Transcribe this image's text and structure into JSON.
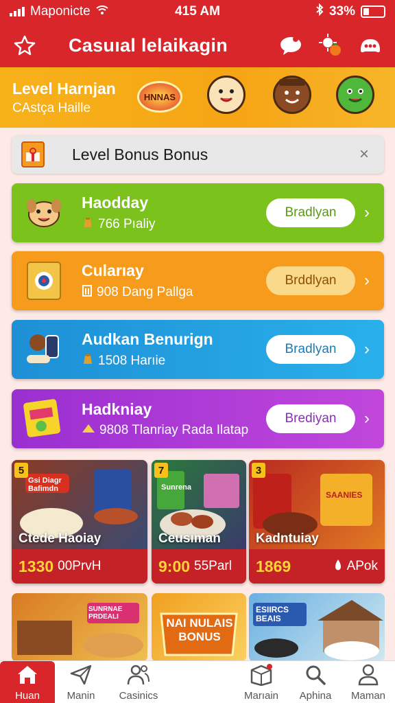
{
  "status_bar": {
    "carrier": "Maponicte",
    "time": "415 AM",
    "battery": "33%"
  },
  "app_bar": {
    "title": "Casuıal lelaikagin"
  },
  "banner": {
    "title": "Level Harnjan",
    "subtitle": "CAstça Haille",
    "badge_text": "HNNAS"
  },
  "notice": {
    "text": "Level Bonus Bonus",
    "close_label": "×"
  },
  "cards": [
    {
      "title": "Haodday",
      "subtitle": "766 Pıaliy",
      "button": "Bradlyan",
      "color": "#7bc21c",
      "button_text_color": "#5a9a12"
    },
    {
      "title": "Cularıay",
      "subtitle": "908 Dang Pallga",
      "button": "Brddlyan",
      "color": "#f79b1c",
      "button_text_color": "#8a5200"
    },
    {
      "title": "Audkan Benurign",
      "subtitle": "1508 Harıie",
      "button": "Bradlyan",
      "color": "#1f9edc",
      "button_text_color": "#1c7bb5"
    },
    {
      "title": "Hadkniay",
      "subtitle": "9808 Tlanriay  Rada Ilatap",
      "button": "Brediyan",
      "color": "#a437d4",
      "button_text_color": "#8a2fb8"
    }
  ],
  "tiles": [
    {
      "num": "5",
      "label_top": "Gsi Diagr Bafimdn",
      "name": "Ctede Haoiay",
      "price": "1330",
      "sub": "00PrvH"
    },
    {
      "num": "7",
      "label_top": "Sunrena",
      "name": "Ceusıman",
      "price": "9:00",
      "sub": "55Parl"
    },
    {
      "num": "3",
      "label_top": "SAANIES",
      "name": "Kadntuiay",
      "price": "1869",
      "sub": "APok"
    }
  ],
  "bottom_tiles": [
    {
      "label": "SUNRNAE PRDEALI"
    },
    {
      "label": "NAI NULAIS BONUS"
    },
    {
      "label": "ESIIRCS BEAIS"
    }
  ],
  "nav": [
    {
      "label": "Huan",
      "icon": "home-icon",
      "active": true
    },
    {
      "label": "Manin",
      "icon": "send-icon",
      "active": false
    },
    {
      "label": "Casinics",
      "icon": "people-icon",
      "active": false
    },
    {
      "label": "Marıain",
      "icon": "box-icon",
      "active": false
    },
    {
      "label": "Aphina",
      "icon": "search-icon",
      "active": false
    },
    {
      "label": "Maman",
      "icon": "profile-icon",
      "active": false
    }
  ],
  "colors": {
    "primary_red": "#d8262b",
    "banner_orange": "#f7b21a",
    "price_yellow": "#ffd23a"
  }
}
